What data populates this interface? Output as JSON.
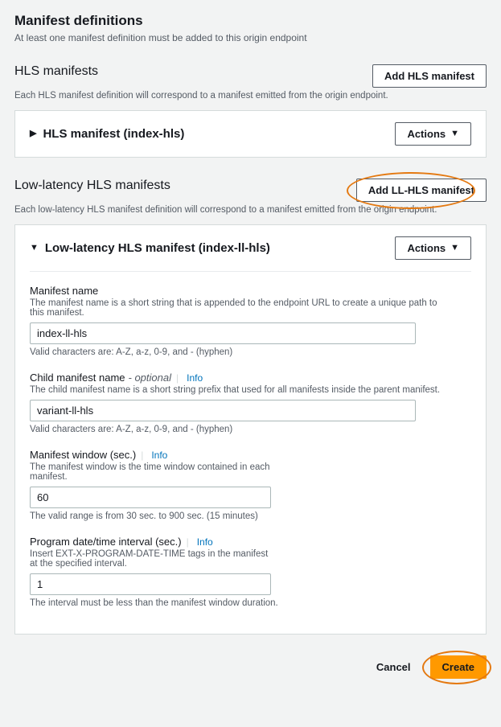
{
  "header": {
    "title": "Manifest definitions",
    "subtitle": "At least one manifest definition must be added to this origin endpoint"
  },
  "hls_section": {
    "title": "HLS manifests",
    "subtitle": "Each HLS manifest definition will correspond to a manifest emitted from the origin endpoint.",
    "add_button": "Add HLS manifest",
    "panel_title": "HLS manifest (index-hls)",
    "actions_label": "Actions"
  },
  "llhls_section": {
    "title": "Low-latency HLS manifests",
    "subtitle": "Each low-latency HLS manifest definition will correspond to a manifest emitted from the origin endpoint.",
    "add_button": "Add LL-HLS manifest",
    "panel_title": "Low-latency HLS manifest (index-ll-hls)",
    "actions_label": "Actions"
  },
  "info_label": "Info",
  "fields": {
    "manifest_name": {
      "label": "Manifest name",
      "desc": "The manifest name is a short string that is appended to the endpoint URL to create a unique path to this manifest.",
      "value": "index-ll-hls",
      "constraint": "Valid characters are: A-Z, a-z, 0-9, and - (hyphen)"
    },
    "child_manifest_name": {
      "label": "Child manifest name",
      "optional": "- optional",
      "desc": "The child manifest name is a short string prefix that used for all manifests inside the parent manifest.",
      "value": "variant-ll-hls",
      "constraint": "Valid characters are: A-Z, a-z, 0-9, and - (hyphen)"
    },
    "manifest_window": {
      "label": "Manifest window (sec.)",
      "desc": "The manifest window is the time window contained in each manifest.",
      "value": "60",
      "constraint": "The valid range is from 30 sec. to 900 sec. (15 minutes)"
    },
    "program_datetime": {
      "label": "Program date/time interval (sec.)",
      "desc": "Insert EXT-X-PROGRAM-DATE-TIME tags in the manifest at the specified interval.",
      "value": "1",
      "constraint": "The interval must be less than the manifest window duration."
    }
  },
  "footer": {
    "cancel": "Cancel",
    "create": "Create"
  }
}
